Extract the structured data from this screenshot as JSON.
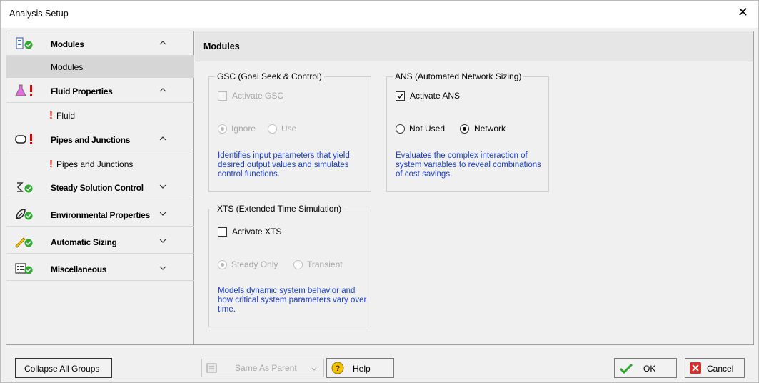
{
  "window": {
    "title": "Analysis Setup"
  },
  "sidebar": {
    "groups": [
      {
        "label": "Modules",
        "icon": "modules-ok-icon",
        "expanded": true,
        "items": [
          {
            "label": "Modules",
            "selected": true,
            "warning": false
          }
        ]
      },
      {
        "label": "Fluid Properties",
        "icon": "flask-warning-icon",
        "expanded": true,
        "items": [
          {
            "label": "Fluid",
            "selected": false,
            "warning": true
          }
        ]
      },
      {
        "label": "Pipes and Junctions",
        "icon": "pipe-warning-icon",
        "expanded": true,
        "items": [
          {
            "label": "Pipes and Junctions",
            "selected": false,
            "warning": true
          }
        ]
      },
      {
        "label": "Steady Solution Control",
        "icon": "solution-ok-icon",
        "expanded": false
      },
      {
        "label": "Environmental Properties",
        "icon": "leaf-ok-icon",
        "expanded": false
      },
      {
        "label": "Automatic Sizing",
        "icon": "ruler-ok-icon",
        "expanded": false
      },
      {
        "label": "Miscellaneous",
        "icon": "list-ok-icon",
        "expanded": false
      }
    ]
  },
  "content": {
    "title": "Modules",
    "gsc": {
      "legend": "GSC (Goal Seek & Control)",
      "activate_label": "Activate GSC",
      "activate_checked": false,
      "enabled": false,
      "options": [
        "Ignore",
        "Use"
      ],
      "selected": "Ignore",
      "description": "Identifies input parameters that yield desired output values and simulates control functions."
    },
    "ans": {
      "legend": "ANS (Automated Network Sizing)",
      "activate_label": "Activate ANS",
      "activate_checked": true,
      "enabled": true,
      "options": [
        "Not Used",
        "Network"
      ],
      "selected": "Network",
      "description": "Evaluates the complex interaction of system variables to reveal combinations of cost savings."
    },
    "xts": {
      "legend": "XTS (Extended Time Simulation)",
      "activate_label": "Activate XTS",
      "activate_checked": false,
      "enabled": false,
      "options": [
        "Steady Only",
        "Transient"
      ],
      "selected": "Steady Only",
      "description": "Models dynamic system behavior and how critical system parameters vary over time."
    }
  },
  "footer": {
    "collapse_label": "Collapse All Groups",
    "same_as_parent_label": "Same As Parent",
    "help_label": "Help",
    "ok_label": "OK",
    "cancel_label": "Cancel"
  },
  "colors": {
    "accent_green": "#2fa82f",
    "warning_red": "#e00000",
    "description_blue": "#1a3cd8",
    "cancel_red": "#d9302c"
  }
}
